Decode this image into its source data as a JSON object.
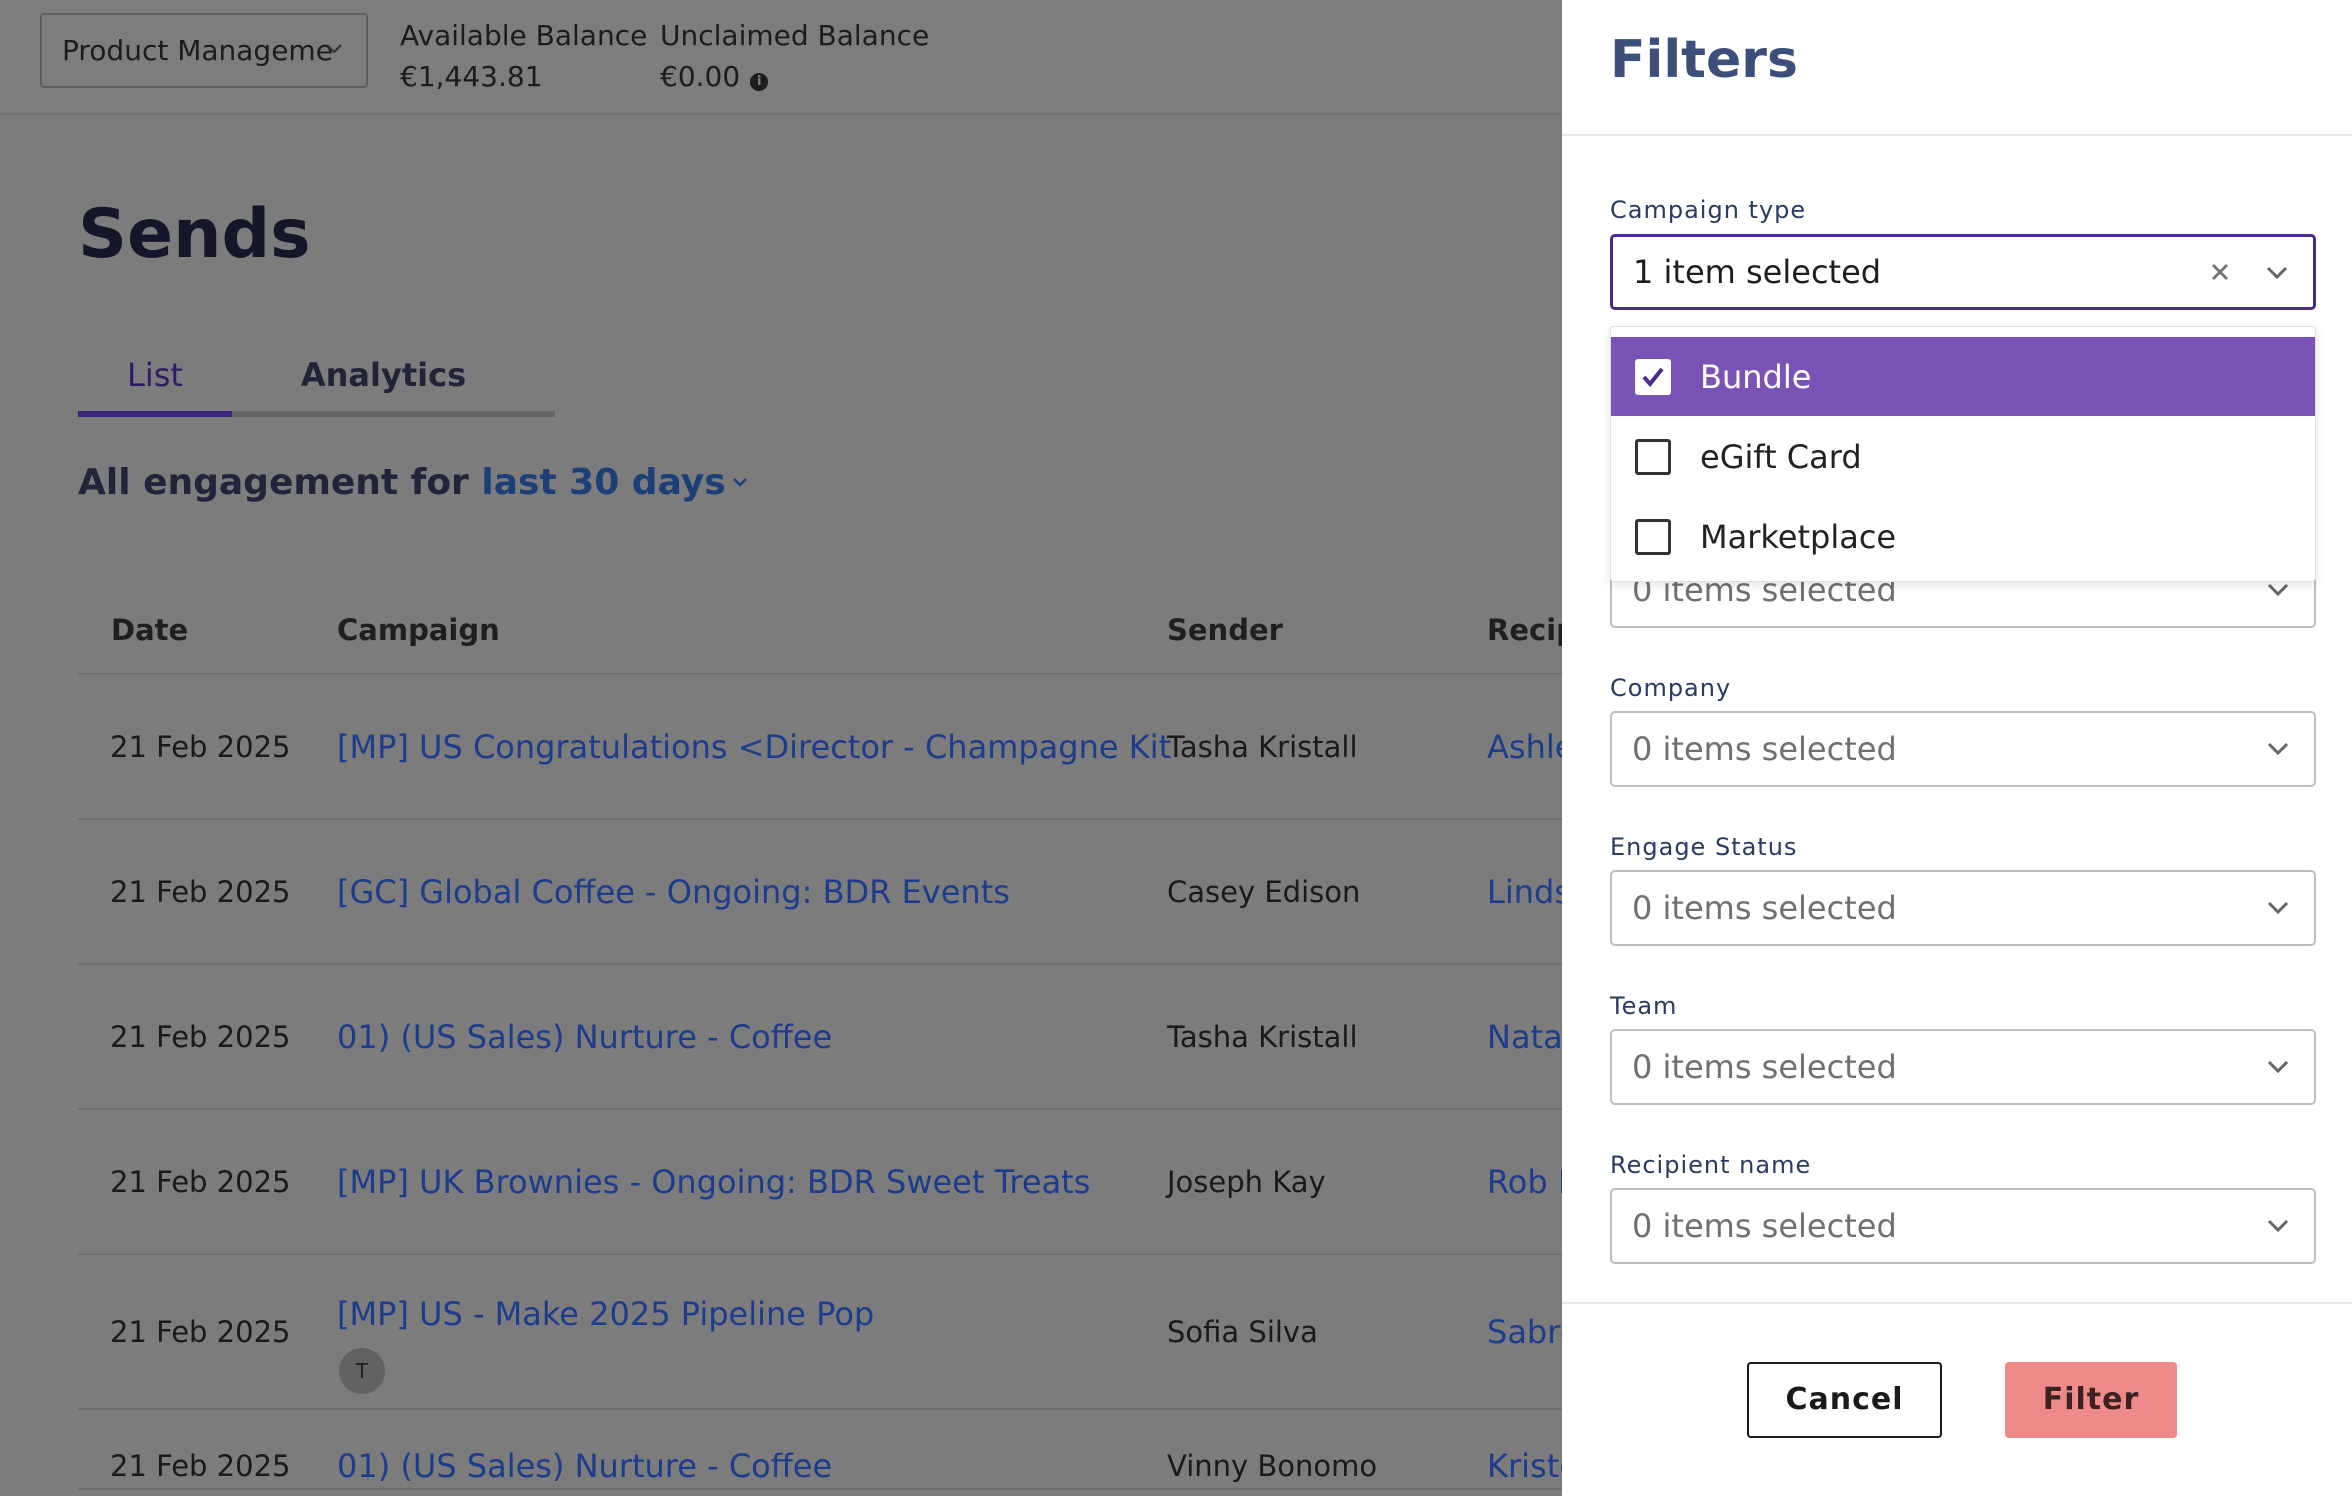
{
  "header": {
    "account_select": "Product Manageme",
    "available_balance_label": "Available Balance",
    "available_balance_value": "€1,443.81",
    "unclaimed_balance_label": "Unclaimed Balance",
    "unclaimed_balance_value": "€0.00"
  },
  "page": {
    "title": "Sends",
    "tabs": [
      {
        "label": "List"
      },
      {
        "label": "Analytics"
      }
    ],
    "engagement_prefix": "All engagement for",
    "engagement_range": "last 30 days"
  },
  "table": {
    "columns": [
      "Date",
      "Campaign",
      "Sender",
      "Recip"
    ],
    "rows": [
      {
        "date": "21 Feb 2025",
        "campaign": "[MP] US Congratulations <Director - Champagne Kit",
        "sender": "Tasha Kristall",
        "recipient": "Ashle"
      },
      {
        "date": "21 Feb 2025",
        "campaign": "[GC] Global Coffee - Ongoing: BDR Events",
        "sender": "Casey Edison",
        "recipient": "Linds"
      },
      {
        "date": "21 Feb 2025",
        "campaign": "01) (US Sales) Nurture - Coffee",
        "sender": "Tasha Kristall",
        "recipient": "Natal"
      },
      {
        "date": "21 Feb 2025",
        "campaign": "[MP] UK Brownies - Ongoing: BDR Sweet Treats",
        "sender": "Joseph Kay",
        "recipient": "Rob F"
      },
      {
        "date": "21 Feb 2025",
        "campaign": "[MP] US - Make 2025 Pipeline Pop",
        "badge": "T",
        "sender": "Sofia Silva",
        "recipient": "Sabre"
      },
      {
        "date": "21 Feb 2025",
        "campaign": "01) (US Sales) Nurture - Coffee",
        "sender": "Vinny Bonomo",
        "recipient": "Kriste"
      }
    ]
  },
  "filters": {
    "title": "Filters",
    "campaign_type": {
      "label": "Campaign type",
      "value": "1 item selected",
      "options": [
        {
          "label": "Bundle",
          "checked": true
        },
        {
          "label": "eGift Card",
          "checked": false
        },
        {
          "label": "Marketplace",
          "checked": false
        }
      ]
    },
    "hidden_field_value": "0 items selected",
    "company": {
      "label": "Company",
      "value": "0 items selected"
    },
    "engage_status": {
      "label": "Engage Status",
      "value": "0 items selected"
    },
    "team": {
      "label": "Team",
      "value": "0 items selected"
    },
    "recipient_name": {
      "label": "Recipient name",
      "value": "0 items selected"
    },
    "cancel_label": "Cancel",
    "filter_label": "Filter"
  },
  "colors": {
    "accent": "#4b2a8e",
    "selected_option": "#7a53b6",
    "filter_button": "#ee8a8a",
    "link": "#1e3c8c",
    "overlay": "#7c7c7c"
  }
}
